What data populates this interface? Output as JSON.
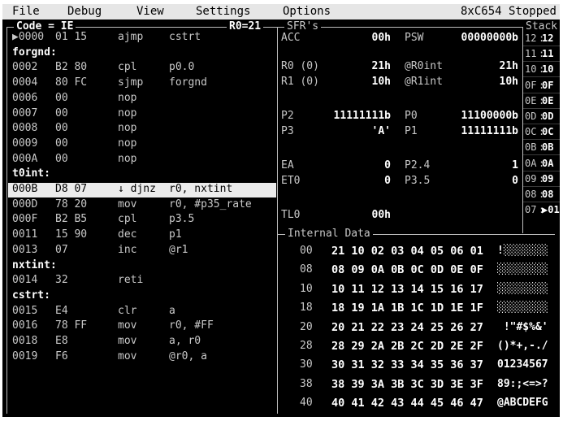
{
  "menu": {
    "items": [
      "File",
      "Debug",
      "View",
      "Settings",
      "Options"
    ],
    "status": "8xC654 Stopped"
  },
  "code_panel": {
    "title": "Code = IE",
    "register": "R0=21",
    "rows": [
      {
        "type": "code",
        "addr": "▶0000",
        "bytes": "01 15",
        "mnem": "ajmp",
        "ops": "cstrt"
      },
      {
        "type": "label",
        "text": "forgnd:"
      },
      {
        "type": "code",
        "addr": "0002",
        "bytes": "B2 80",
        "mnem": "cpl",
        "ops": "p0.0"
      },
      {
        "type": "code",
        "addr": "0004",
        "bytes": "80 FC",
        "mnem": "sjmp",
        "ops": "forgnd"
      },
      {
        "type": "code",
        "addr": "0006",
        "bytes": "00",
        "mnem": "nop",
        "ops": ""
      },
      {
        "type": "code",
        "addr": "0007",
        "bytes": "00",
        "mnem": "nop",
        "ops": ""
      },
      {
        "type": "code",
        "addr": "0008",
        "bytes": "00",
        "mnem": "nop",
        "ops": ""
      },
      {
        "type": "code",
        "addr": "0009",
        "bytes": "00",
        "mnem": "nop",
        "ops": ""
      },
      {
        "type": "code",
        "addr": "000A",
        "bytes": "00",
        "mnem": "nop",
        "ops": ""
      },
      {
        "type": "label",
        "text": "t0int:"
      },
      {
        "type": "code",
        "addr": "000B",
        "bytes": "D8 07",
        "mnem": "↓ djnz",
        "ops": "r0, nxtint",
        "selected": true
      },
      {
        "type": "code",
        "addr": "000D",
        "bytes": "78 20",
        "mnem": "mov",
        "ops": "r0, #p35_rate"
      },
      {
        "type": "code",
        "addr": "000F",
        "bytes": "B2 B5",
        "mnem": "cpl",
        "ops": "p3.5"
      },
      {
        "type": "code",
        "addr": "0011",
        "bytes": "15 90",
        "mnem": "dec",
        "ops": "p1"
      },
      {
        "type": "code",
        "addr": "0013",
        "bytes": "07",
        "mnem": "inc",
        "ops": "@r1"
      },
      {
        "type": "label",
        "text": "nxtint:"
      },
      {
        "type": "code",
        "addr": "0014",
        "bytes": "32",
        "mnem": "reti",
        "ops": ""
      },
      {
        "type": "label",
        "text": "cstrt:"
      },
      {
        "type": "code",
        "addr": "0015",
        "bytes": "E4",
        "mnem": "clr",
        "ops": "a"
      },
      {
        "type": "code",
        "addr": "0016",
        "bytes": "78 FF",
        "mnem": "mov",
        "ops": "r0, #FF"
      },
      {
        "type": "code",
        "addr": "0018",
        "bytes": "E8",
        "mnem": "mov",
        "ops": "a, r0"
      },
      {
        "type": "code",
        "addr": "0019",
        "bytes": "F6",
        "mnem": "mov",
        "ops": "@r0, a"
      }
    ]
  },
  "sfr_panel": {
    "title": "SFR's",
    "rows": [
      {
        "l1": "ACC",
        "v1": "00h",
        "l2": "PSW",
        "v2": "00000000b"
      },
      {
        "l1": "R0 (0)",
        "v1": "21h",
        "l2": "@R0int",
        "v2": "21h"
      },
      {
        "l1": "R1 (0)",
        "v1": "10h",
        "l2": "@R1int",
        "v2": "10h"
      },
      {
        "l1": "P2",
        "v1": "11111111b",
        "l2": "P0",
        "v2": "11100000b"
      },
      {
        "l1": "P3",
        "v1": "'A'",
        "l2": "P1",
        "v2": "11111111b"
      },
      {
        "l1": "EA",
        "v1": "0",
        "l2": "P2.4",
        "v2": "1"
      },
      {
        "l1": "ET0",
        "v1": "0",
        "l2": "P3.5",
        "v2": "0"
      },
      {
        "l1": "TL0",
        "v1": "00h",
        "l2": "",
        "v2": ""
      }
    ]
  },
  "stack_panel": {
    "title": "Stack",
    "rows": [
      {
        "a": "12",
        "v": "12"
      },
      {
        "a": "11",
        "v": "11"
      },
      {
        "a": "10",
        "v": "10"
      },
      {
        "a": "0F",
        "v": "0F"
      },
      {
        "a": "0E",
        "v": "0E"
      },
      {
        "a": "0D",
        "v": "0D"
      },
      {
        "a": "0C",
        "v": "0C"
      },
      {
        "a": "0B",
        "v": "0B"
      },
      {
        "a": "0A",
        "v": "0A"
      },
      {
        "a": "09",
        "v": "09"
      },
      {
        "a": "08",
        "v": "08"
      },
      {
        "a": "07",
        "v": "▶01"
      }
    ]
  },
  "internal_data": {
    "title": "Internal Data",
    "rows": [
      {
        "addr": "00",
        "bytes": "21 10 02 03 04 05 06 01",
        "ascii": "!░░░░░░░"
      },
      {
        "addr": "08",
        "bytes": "08 09 0A 0B 0C 0D 0E 0F",
        "ascii": "░░░░░░░░"
      },
      {
        "addr": "10",
        "bytes": "10 11 12 13 14 15 16 17",
        "ascii": "░░░░░░░░"
      },
      {
        "addr": "18",
        "bytes": "18 19 1A 1B 1C 1D 1E 1F",
        "ascii": "░░░░░░░░"
      },
      {
        "addr": "20",
        "bytes": "20 21 22 23 24 25 26 27",
        "ascii": " !\"#$%&'"
      },
      {
        "addr": "28",
        "bytes": "28 29 2A 2B 2C 2D 2E 2F",
        "ascii": "()*+,-./"
      },
      {
        "addr": "30",
        "bytes": "30 31 32 33 34 35 36 37",
        "ascii": "01234567"
      },
      {
        "addr": "38",
        "bytes": "38 39 3A 3B 3C 3D 3E 3F",
        "ascii": "89:;<=>?"
      },
      {
        "addr": "40",
        "bytes": "40 41 42 43 44 45 46 47",
        "ascii": "@ABCDEFG"
      }
    ]
  }
}
